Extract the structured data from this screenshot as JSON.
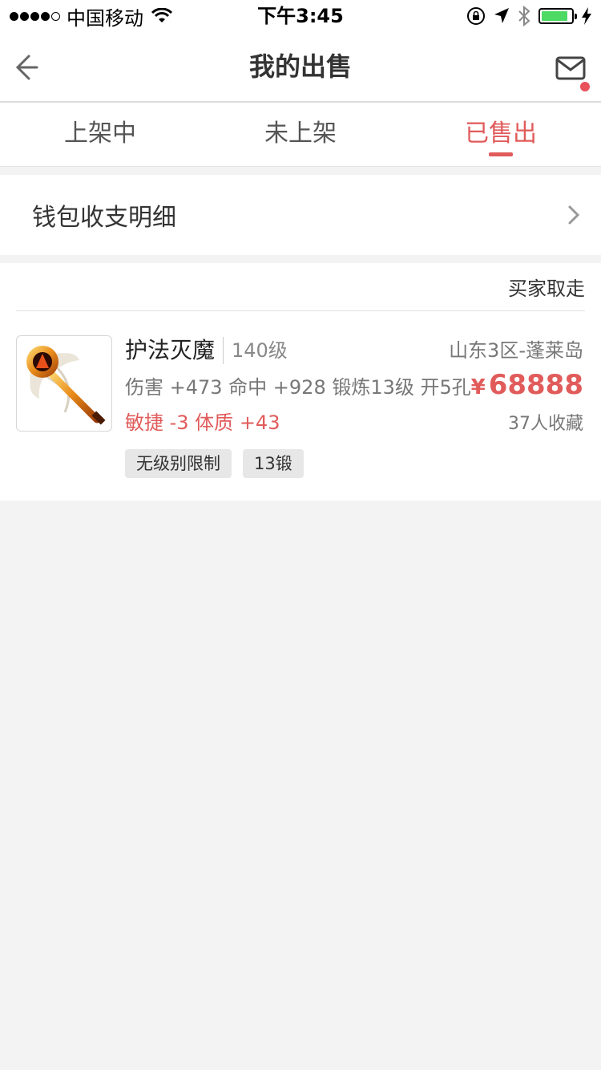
{
  "status_bar": {
    "carrier": "中国移动",
    "time": "下午3:45",
    "signal_dots": 5,
    "signal_filled": 4,
    "battery_level": 0.9,
    "battery_color": "#4cd964"
  },
  "nav": {
    "title": "我的出售",
    "back_icon": "arrow-left-icon",
    "mail_icon": "envelope-icon",
    "has_unread": true
  },
  "tabs": [
    {
      "label": "上架中",
      "active": false
    },
    {
      "label": "未上架",
      "active": false
    },
    {
      "label": "已售出",
      "active": true
    }
  ],
  "wallet": {
    "label": "钱包收支明细",
    "chevron_icon": "chevron-right-icon"
  },
  "order": {
    "status": "买家取走",
    "item": {
      "name": "护法灭魔",
      "level": "140级",
      "server": "山东3区-蓬莱岛",
      "attributes": "伤害 +473 命中 +928 锻炼13级 开5孔",
      "bonus": "敏捷 -3 体质 +43",
      "currency": "¥",
      "price": "68888",
      "favorites": "37人收藏",
      "tags": [
        "无级别限制",
        "13锻"
      ]
    }
  },
  "colors": {
    "accent": "#e15b5b",
    "background": "#f3f3f3",
    "tag_bg": "#e7e7e7"
  }
}
